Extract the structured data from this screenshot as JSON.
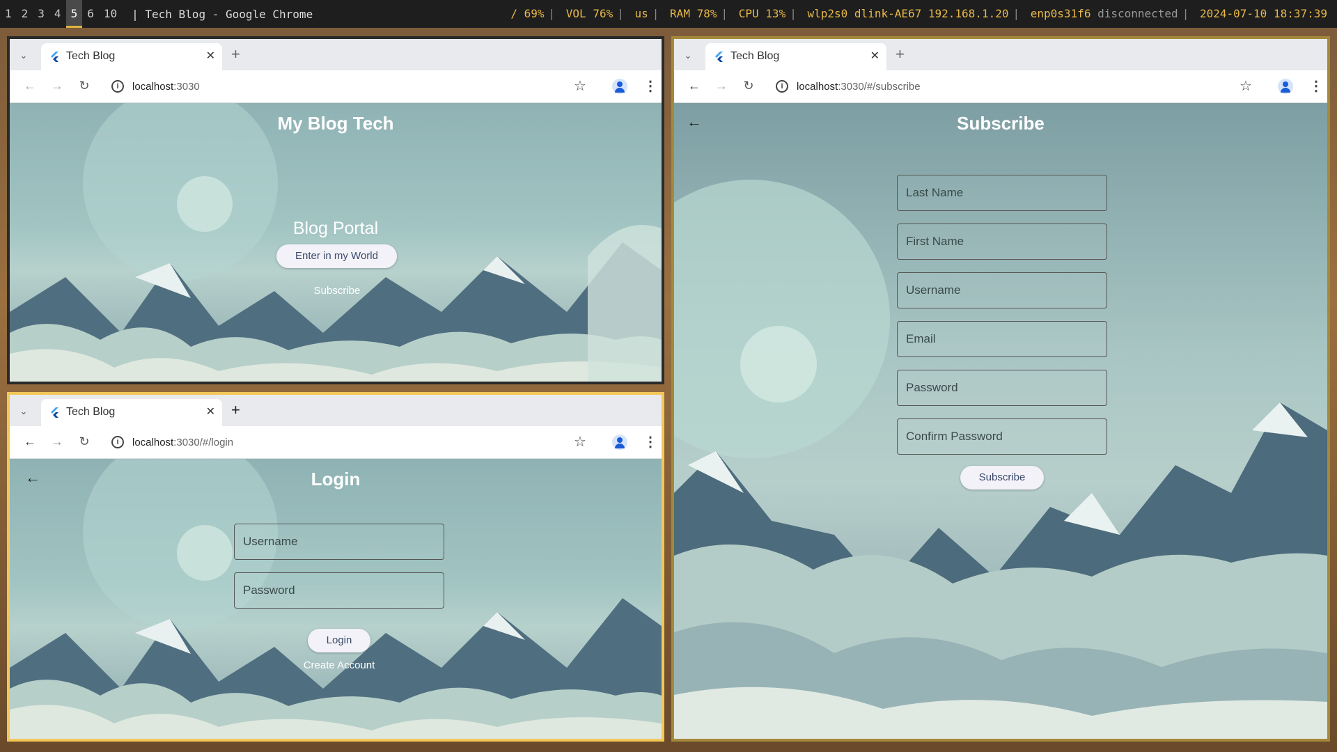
{
  "topbar": {
    "workspaces": [
      "1",
      "2",
      "3",
      "4",
      "5",
      "6",
      "10"
    ],
    "active_workspace": "5",
    "window_title": "Tech Blog - Google Chrome",
    "status": {
      "disk": "/ 69%",
      "volume": "VOL 76%",
      "layout": "us",
      "ram": "RAM 78%",
      "cpu": "CPU 13%",
      "wifi": "wlp2s0 dlink-AE67 192.168.1.20",
      "eth_iface": "enp0s31f6",
      "eth_state": "disconnected",
      "datetime": "2024-07-10 18:37:39"
    }
  },
  "windows": {
    "home": {
      "tab_title": "Tech Blog",
      "url_host": "localhost",
      "url_rest": ":3030",
      "page_title": "My Blog Tech",
      "portal_label": "Blog Portal",
      "enter_button": "Enter in my World",
      "subscribe_link": "Subscribe"
    },
    "login": {
      "tab_title": "Tech Blog",
      "url_host": "localhost",
      "url_rest": ":3030/#/login",
      "page_title": "Login",
      "username_placeholder": "Username",
      "password_placeholder": "Password",
      "login_button": "Login",
      "create_account": "Create Account"
    },
    "subscribe": {
      "tab_title": "Tech Blog",
      "url_host": "localhost",
      "url_rest": ":3030/#/subscribe",
      "page_title": "Subscribe",
      "fields": [
        "Last Name",
        "First Name",
        "Username",
        "Email",
        "Password",
        "Confirm Password"
      ],
      "subscribe_button": "Subscribe"
    }
  },
  "colors": {
    "focused_border": "#f2c75a",
    "topbar_bg": "#1e1e1e",
    "status_accent": "#e8b84a"
  },
  "icons": [
    "chevron-down-icon",
    "flutter-icon",
    "close-icon",
    "plus-icon",
    "back-icon",
    "forward-icon",
    "reload-icon",
    "info-icon",
    "star-icon",
    "profile-icon",
    "kebab-menu-icon",
    "arrow-back-icon"
  ]
}
